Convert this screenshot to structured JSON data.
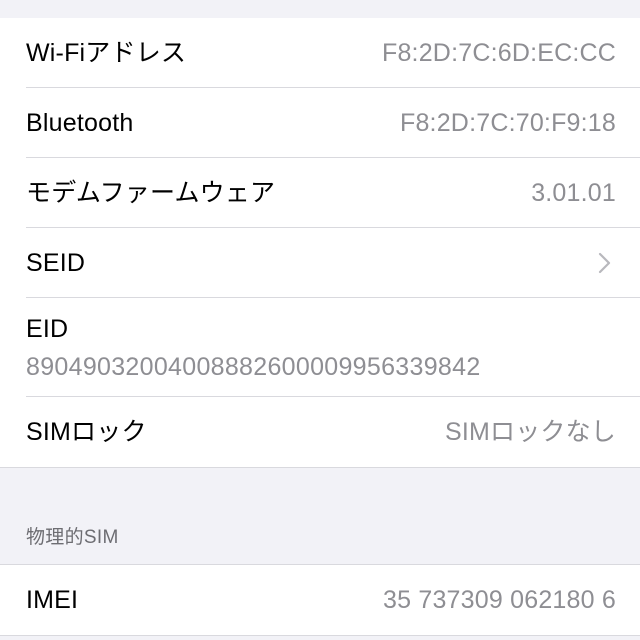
{
  "screen": {
    "name": "device-info-settings",
    "background_color": "#f2f2f7",
    "card_color": "#ffffff",
    "separator_color": "#d9d9de",
    "label_color": "#000000",
    "value_color": "#8e8e93"
  },
  "section_device": {
    "rows": [
      {
        "label": "Wi-Fiアドレス",
        "value": "F8:2D:7C:6D:EC:CC"
      },
      {
        "label": "Bluetooth",
        "value": "F8:2D:7C:70:F9:18"
      },
      {
        "label": "モデムファームウェア",
        "value": "3.01.01"
      },
      {
        "label": "SEID",
        "value": "",
        "accessory": "chevron-right-icon"
      },
      {
        "label": "EID",
        "value": "89049032004008882600009956339842"
      },
      {
        "label": "SIMロック",
        "value": "SIMロックなし"
      }
    ]
  },
  "section_physical_sim": {
    "header": "物理的SIM",
    "rows": [
      {
        "label": "IMEI",
        "value": "35 737309 062180 6"
      }
    ]
  }
}
